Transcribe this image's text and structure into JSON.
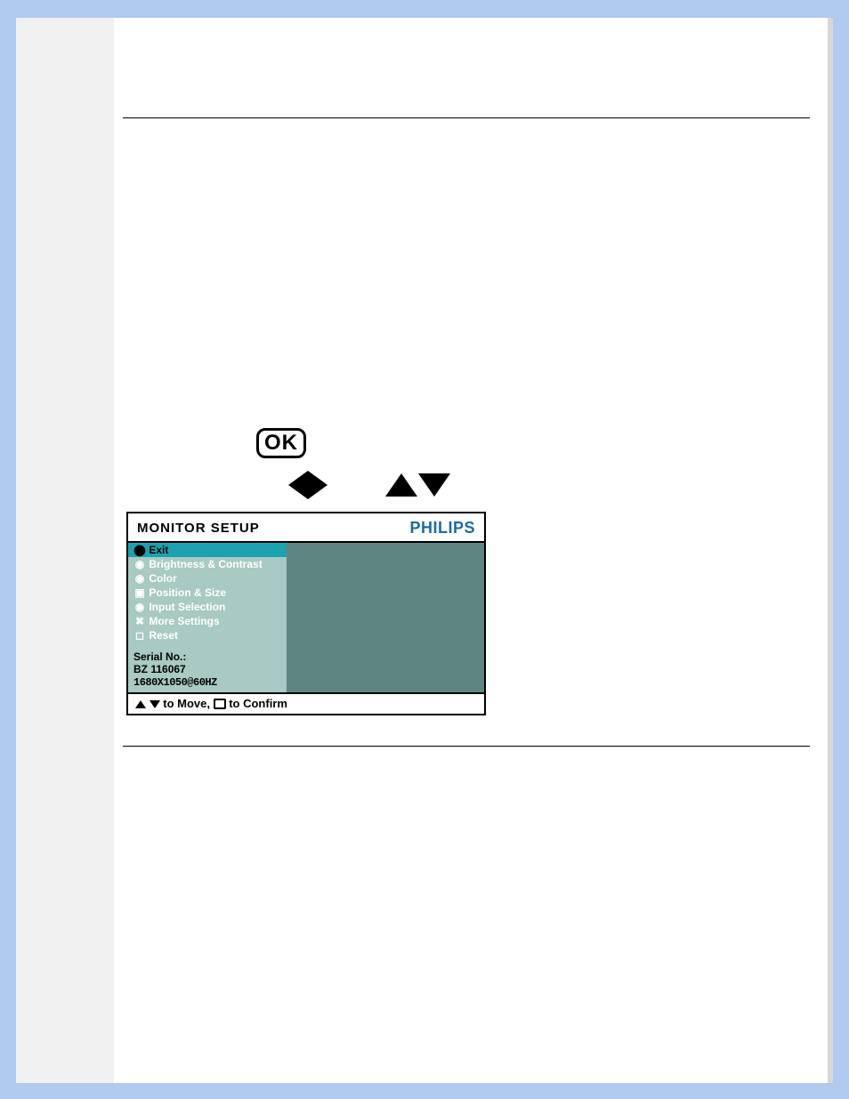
{
  "controls": {
    "ok_label": "OK"
  },
  "osd": {
    "title": "MONITOR SETUP",
    "brand": "PHILIPS",
    "menu": [
      {
        "icon": "⬤",
        "label": "Exit",
        "selected": true
      },
      {
        "icon": "◉",
        "label": "Brightness & Contrast",
        "selected": false
      },
      {
        "icon": "◉",
        "label": "Color",
        "selected": false
      },
      {
        "icon": "▣",
        "label": "Position & Size",
        "selected": false
      },
      {
        "icon": "◉",
        "label": "Input Selection",
        "selected": false
      },
      {
        "icon": "✖",
        "label": "More Settings",
        "selected": false
      },
      {
        "icon": "◻",
        "label": "Reset",
        "selected": false
      }
    ],
    "serial_label": "Serial No.:",
    "serial_value": "BZ 116067",
    "mode": "1680X1050@60HZ",
    "footer_move": " to Move, ",
    "footer_confirm": " to Confirm"
  }
}
